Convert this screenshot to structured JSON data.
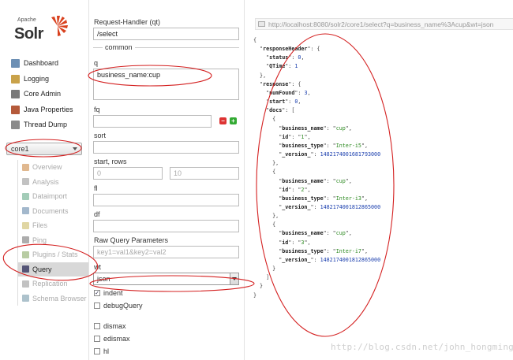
{
  "logo": {
    "brand_top": "Apache",
    "brand_main": "Solr"
  },
  "nav": {
    "items": [
      {
        "label": "Dashboard",
        "icon": "dashboard-icon"
      },
      {
        "label": "Logging",
        "icon": "logging-icon"
      },
      {
        "label": "Core Admin",
        "icon": "core-admin-icon"
      },
      {
        "label": "Java Properties",
        "icon": "java-icon"
      },
      {
        "label": "Thread Dump",
        "icon": "thread-dump-icon"
      }
    ],
    "core_selector": "core1",
    "core_menu": [
      {
        "label": "Overview",
        "icon": "overview-icon"
      },
      {
        "label": "Analysis",
        "icon": "analysis-icon"
      },
      {
        "label": "Dataimport",
        "icon": "dataimport-icon"
      },
      {
        "label": "Documents",
        "icon": "documents-icon"
      },
      {
        "label": "Files",
        "icon": "files-icon"
      },
      {
        "label": "Ping",
        "icon": "ping-icon"
      },
      {
        "label": "Plugins / Stats",
        "icon": "plugins-icon"
      },
      {
        "label": "Query",
        "icon": "query-icon",
        "active": true
      },
      {
        "label": "Replication",
        "icon": "replication-icon"
      },
      {
        "label": "Schema Browser",
        "icon": "schema-icon"
      }
    ]
  },
  "form": {
    "qt_label": "Request-Handler (qt)",
    "qt_value": "/select",
    "common_label": "common",
    "q_label": "q",
    "q_value": "business_name:cup",
    "fq_label": "fq",
    "fq_value": "",
    "sort_label": "sort",
    "sort_value": "",
    "start_rows_label": "start, rows",
    "start_value": "0",
    "rows_value": "10",
    "fl_label": "fl",
    "fl_value": "",
    "df_label": "df",
    "df_value": "",
    "raw_label": "Raw Query Parameters",
    "raw_placeholder": "key1=val1&key2=val2",
    "wt_label": "wt",
    "wt_value": "json",
    "indent_label": "indent",
    "indent_checked": true,
    "debug_label": "debugQuery",
    "dismax_label": "dismax",
    "edismax_label": "edismax",
    "hl_label": "hl"
  },
  "response": {
    "url": "http://localhost:8080/solr2/core1/select?q=business_name%3Acup&wt=json",
    "status": 0,
    "qtime": 1,
    "num_found": 3,
    "start": 0,
    "docs": [
      {
        "business_name": "cup",
        "id": "1",
        "business_type": "Inter-i5",
        "version": "1482174001681793000"
      },
      {
        "business_name": "cup",
        "id": "2",
        "business_type": "Inter-i3",
        "version": "1482174001812865000"
      },
      {
        "business_name": "cup",
        "id": "3",
        "business_type": "Inter-i7",
        "version": "1482174001812865000"
      }
    ]
  },
  "watermark": "http://blog.csdn.net/john_hongming",
  "colors": {
    "annotation_red": "#d42020",
    "minus_red": "#d33",
    "plus_green": "#3a3"
  }
}
